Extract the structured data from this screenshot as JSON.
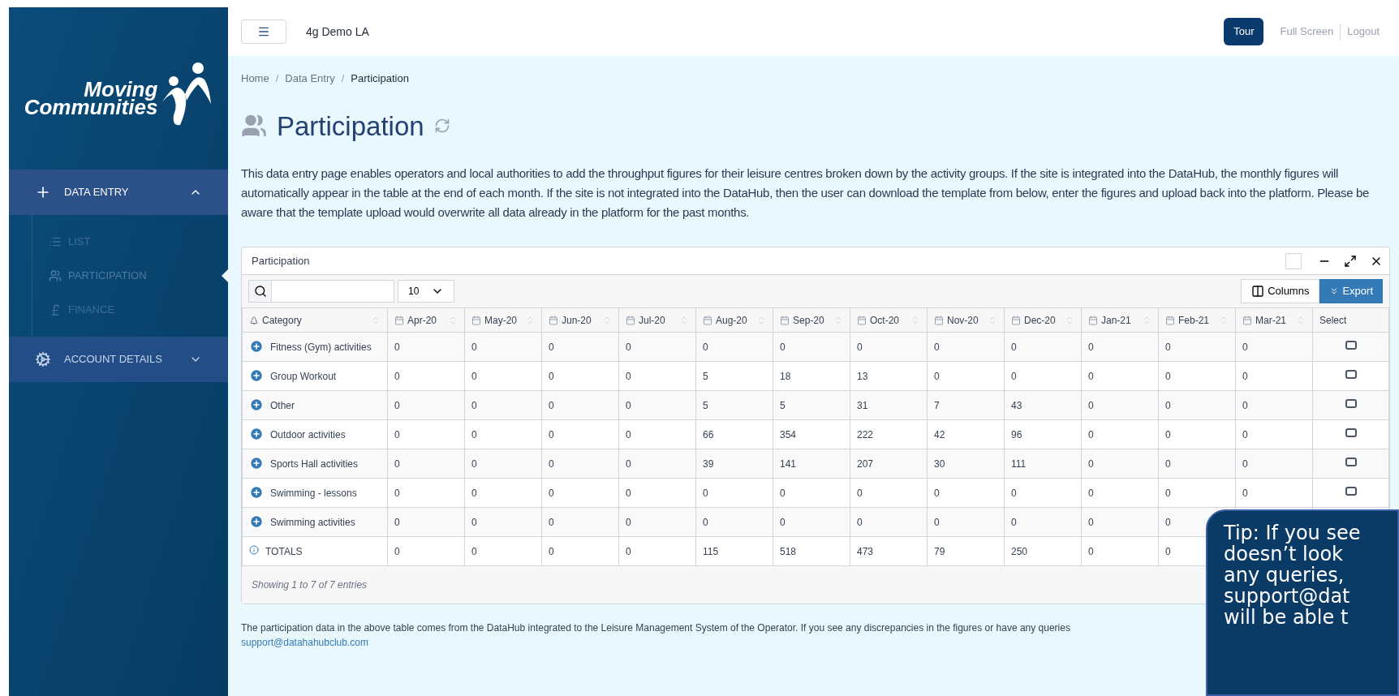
{
  "sidebar": {
    "logo_text": [
      "Moving",
      "Communities"
    ],
    "items": [
      {
        "label": "DATA ENTRY",
        "expanded": true,
        "children": [
          {
            "label": "LIST",
            "selected": false
          },
          {
            "label": "PARTICIPATION",
            "selected": true
          },
          {
            "label": "FINANCE",
            "selected": false
          }
        ]
      },
      {
        "label": "ACCOUNT DETAILS",
        "expanded": false
      }
    ]
  },
  "topbar": {
    "org": "4g Demo LA",
    "tour": "Tour",
    "links": [
      "Full Screen",
      "Logout"
    ]
  },
  "breadcrumb": [
    {
      "label": "Home",
      "current": false
    },
    {
      "separator": "/",
      "label": "Data Entry",
      "current": false
    },
    {
      "separator": "/",
      "label": "Participation",
      "current": true
    }
  ],
  "page_title": "Participation",
  "description": "This data entry page enables operators and local authorities to add the throughput figures for their leisure centres broken down by the activity groups. If the site is integrated into the DataHub, the monthly figures will automatically appear in the table at the end of each month. If the site is not integrated into the DataHub, then the user can download the template from below, enter the figures and upload back into the platform. Please be aware that the template upload would overwrite all data already in the platform for the past months.",
  "panel": {
    "title": "Participation",
    "checkbox_checked": false,
    "page_size": "10",
    "columns_button": "Columns",
    "export_button": "Export",
    "table": {
      "columns": [
        "Category",
        "Apr-20",
        "May-20",
        "Jun-20",
        "Jul-20",
        "Aug-20",
        "Sep-20",
        "Oct-20",
        "Nov-20",
        "Dec-20",
        "Jan-21",
        "Feb-21",
        "Mar-21",
        "Select"
      ],
      "rows": [
        {
          "kind": "category",
          "category": "Fitness (Gym) activities",
          "values": [
            "0",
            "0",
            "0",
            "0",
            "0",
            "0",
            "0",
            "0",
            "0",
            "0",
            "0",
            "0"
          ],
          "checked": false
        },
        {
          "kind": "category",
          "category": "Group Workout",
          "values": [
            "0",
            "0",
            "0",
            "0",
            "5",
            "18",
            "13",
            "0",
            "0",
            "0",
            "0",
            "0"
          ],
          "checked": false
        },
        {
          "kind": "category",
          "category": "Other",
          "values": [
            "0",
            "0",
            "0",
            "0",
            "5",
            "5",
            "31",
            "7",
            "43",
            "0",
            "0",
            "0"
          ],
          "checked": false
        },
        {
          "kind": "category",
          "category": "Outdoor activities",
          "values": [
            "0",
            "0",
            "0",
            "0",
            "66",
            "354",
            "222",
            "42",
            "96",
            "0",
            "0",
            "0"
          ],
          "checked": false
        },
        {
          "kind": "category",
          "category": "Sports Hall activities",
          "values": [
            "0",
            "0",
            "0",
            "0",
            "39",
            "141",
            "207",
            "30",
            "111",
            "0",
            "0",
            "0"
          ],
          "checked": false
        },
        {
          "kind": "category",
          "category": "Swimming - lessons",
          "values": [
            "0",
            "0",
            "0",
            "0",
            "0",
            "0",
            "0",
            "0",
            "0",
            "0",
            "0",
            "0"
          ],
          "checked": false
        },
        {
          "kind": "category",
          "category": "Swimming activities",
          "values": [
            "0",
            "0",
            "0",
            "0",
            "0",
            "0",
            "0",
            "0",
            "0",
            "0",
            "0"
          ]
        },
        {
          "kind": "totals",
          "category": "TOTALS",
          "values": [
            "0",
            "0",
            "0",
            "0",
            "115",
            "518",
            "473",
            "79",
            "250",
            "0",
            "0"
          ]
        }
      ]
    },
    "info": "Showing 1 to 7 of 7 entries"
  },
  "footer": {
    "text": "The participation data in the above table comes from the DataHub integrated to the Leisure Management System of the Operator. If you see any discrepancies in the figures or have any queries",
    "email": "support@datahahubclub.com"
  },
  "tip": {
    "lines": [
      "Tip: If you see",
      "doesn’t look",
      "any queries,",
      "support@dat",
      "will be able t"
    ]
  }
}
